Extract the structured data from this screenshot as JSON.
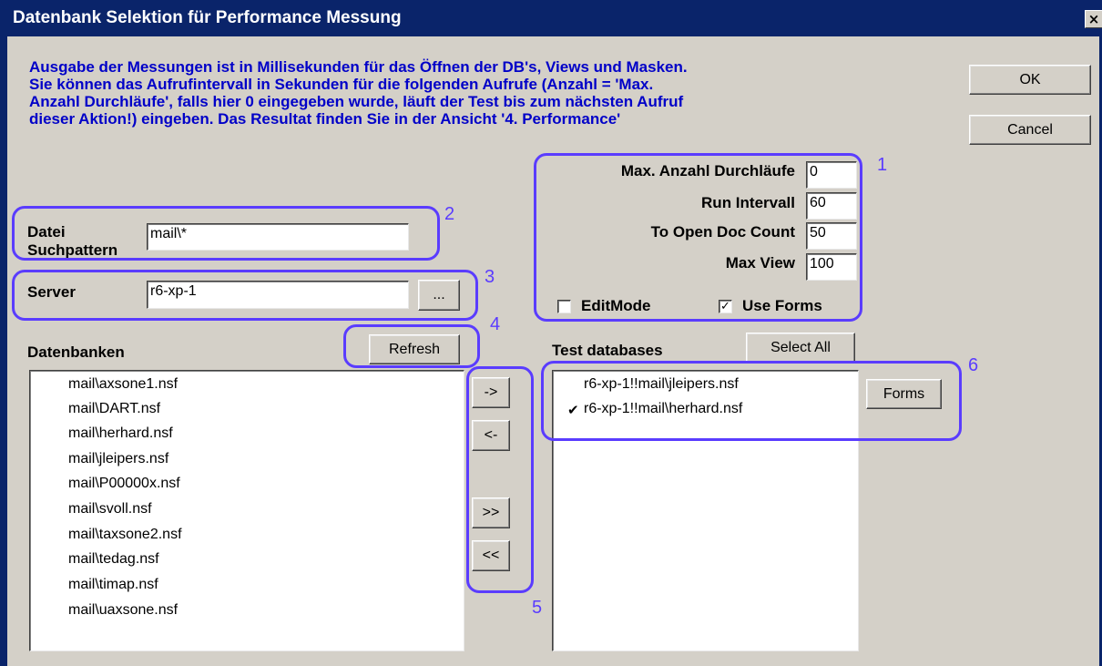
{
  "window": {
    "title": "Datenbank Selektion für Performance Messung",
    "close_glyph": "×"
  },
  "info_lines": [
    "Ausgabe der Messungen ist in Millisekunden für das Öffnen der DB's, Views und Masken.",
    "Sie können das Aufrufintervall in Sekunden für die folgenden Aufrufe (Anzahl = 'Max.",
    "Anzahl Durchläufe', falls hier 0 eingegeben wurde, läuft der Test bis zum nächsten Aufruf",
    "dieser Aktion!) eingeben. Das Resultat finden Sie in der Ansicht '4. Performance'"
  ],
  "buttons": {
    "ok": "OK",
    "cancel": "Cancel",
    "browse": "...",
    "refresh": "Refresh",
    "select_all": "Select All",
    "forms": "Forms",
    "add": "->",
    "remove": "<-",
    "add_all": ">>",
    "remove_all": "<<"
  },
  "settings": {
    "max_runs_label": "Max. Anzahl Durchläufe",
    "max_runs_value": "0",
    "run_interval_label": "Run Intervall",
    "run_interval_value": "60",
    "open_doc_label": "To Open Doc Count",
    "open_doc_value": "50",
    "max_view_label": "Max View",
    "max_view_value": "100",
    "editmode_label": "EditMode",
    "editmode_checked": false,
    "useforms_label": "Use Forms",
    "useforms_checked": true,
    "check_glyph": "✓"
  },
  "search": {
    "label_line1": "Datei",
    "label_line2": "Suchpattern",
    "value": "mail\\*"
  },
  "server": {
    "label": "Server",
    "value": "r6-xp-1"
  },
  "databases": {
    "label": "Datenbanken",
    "items": [
      "mail\\axsone1.nsf",
      "mail\\DART.nsf",
      "mail\\herhard.nsf",
      "mail\\jleipers.nsf",
      "mail\\P00000x.nsf",
      "mail\\svoll.nsf",
      "mail\\taxsone2.nsf",
      "mail\\tedag.nsf",
      "mail\\timap.nsf",
      "mail\\uaxsone.nsf"
    ]
  },
  "test_databases": {
    "label": "Test databases",
    "items": [
      {
        "name": "r6-xp-1!!mail\\jleipers.nsf",
        "check": ""
      },
      {
        "name": "r6-xp-1!!mail\\herhard.nsf",
        "check": "✔"
      }
    ]
  },
  "annotations": [
    "1",
    "2",
    "3",
    "4",
    "5",
    "6"
  ],
  "colors": {
    "title_bar": "#0a246a",
    "info_text": "#0000c8",
    "callout": "#5a3cff",
    "dialog_bg": "#d4d0c8"
  }
}
